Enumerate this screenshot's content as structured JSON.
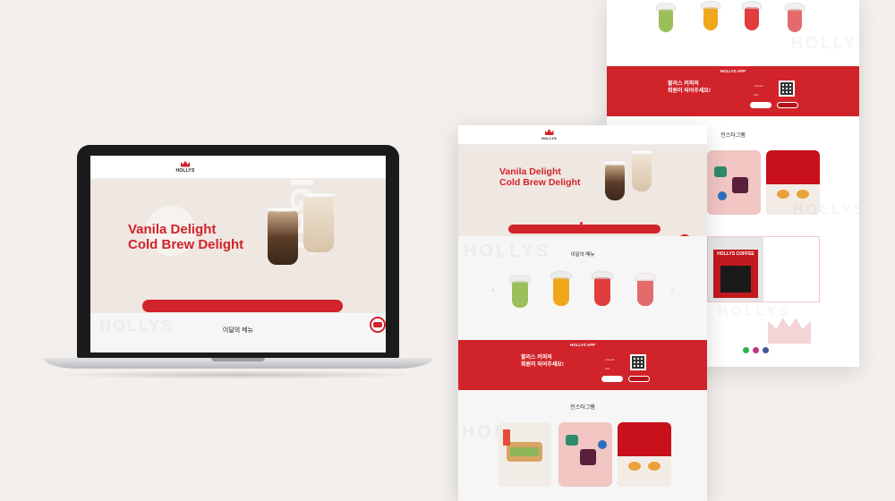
{
  "brand": {
    "logo_text": "HOLLYS",
    "accent": "#d1232a",
    "background": "#f3efec"
  },
  "laptop": {
    "nav": {
      "items": [
        "",
        "",
        "",
        "",
        "",
        ""
      ],
      "right_items": [
        "",
        "",
        ""
      ]
    },
    "hero": {
      "title_line1": "Vanila Delight",
      "title_line2": "Cold Brew Delight",
      "subtitle": "",
      "watermark": "LIGHT",
      "caption_left": "",
      "caption_right": ""
    },
    "notice": {
      "tag1": "",
      "text1": "",
      "tag2": "",
      "text2": ""
    },
    "menu_title": "이달의 메뉴",
    "watermark": "HOLLYS"
  },
  "front_page": {
    "nav": {
      "items": [
        "",
        "",
        "",
        "",
        "",
        ""
      ],
      "right_items": [
        "",
        "",
        ""
      ]
    },
    "hero": {
      "title_line1": "Vanila Delight",
      "title_line2": "Cold Brew Delight",
      "subtitle": ""
    },
    "notice": {
      "tag1": "",
      "text1": "",
      "tag2": "",
      "text2": ""
    },
    "menu_title": "이달의 메뉴",
    "menu_items": [
      {
        "name": "",
        "color": "#9bbf5a"
      },
      {
        "name": "",
        "color": "#f0a71c"
      },
      {
        "name": "",
        "color": "#e23d3d"
      },
      {
        "name": "",
        "color": "#f1dede"
      }
    ],
    "app": {
      "label": "HOLLYS APP",
      "headline_line1": "할리스 커피의",
      "headline_line2": "회원이 되어주세요!",
      "small": "",
      "android": "Android",
      "ios": "iOS",
      "btn1": "",
      "btn2": ""
    },
    "insta": {
      "title": "인스타그램",
      "sub": ""
    },
    "watermark": "HOLLYS"
  },
  "back_page": {
    "menu_items": [
      {
        "name": "",
        "color": "#9bbf5a"
      },
      {
        "name": "",
        "color": "#f0a71c"
      },
      {
        "name": "",
        "color": "#e23d3d"
      },
      {
        "name": "",
        "color": "#f1dede"
      }
    ],
    "app": {
      "label": "HOLLYS APP",
      "headline_line1": "할리스 커피의",
      "headline_line2": "회원이 되어주세요!",
      "android": "Android",
      "ios": "iOS",
      "btn1": "",
      "btn2": ""
    },
    "insta": {
      "title": "인스타그램",
      "sub": ""
    },
    "store_banner": {
      "sign_text": "HOLLYS COFFEE",
      "bullets": [
        "",
        "",
        "",
        "",
        ""
      ]
    },
    "watermark": "HOLLYS"
  }
}
